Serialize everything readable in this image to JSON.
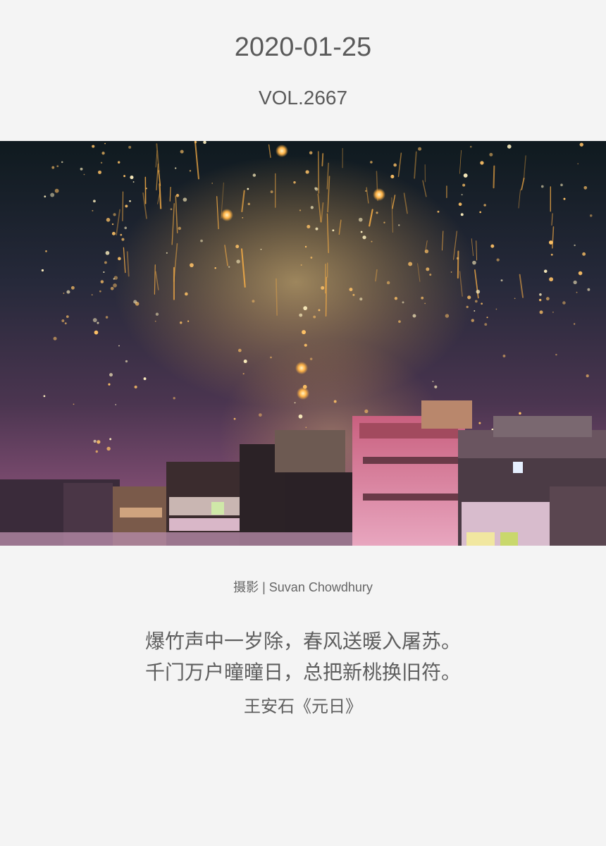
{
  "header": {
    "date": "2020-01-25",
    "volume": "VOL.2667"
  },
  "photo": {
    "subject": "fireworks-over-city",
    "sky_color": "#2b2a3a",
    "spark_color": "#ffb347"
  },
  "credit": {
    "text": "摄影 | Suvan Chowdhury"
  },
  "poem": {
    "lines": [
      "爆竹声中一岁除，春风送暖入屠苏。",
      "千门万户曈曈日，总把新桃换旧符。"
    ],
    "author": "王安石《元日》"
  },
  "colors": {
    "background": "#f4f4f4",
    "text": "#5a5a5a"
  }
}
